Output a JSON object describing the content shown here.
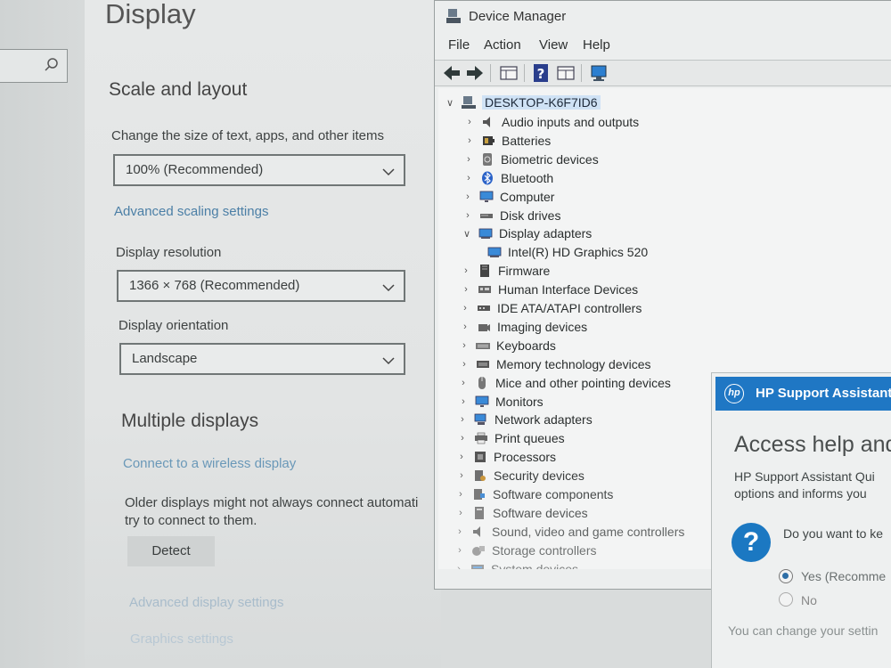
{
  "settings": {
    "title": "Display",
    "scale_heading": "Scale and layout",
    "scale_label": "Change the size of text, apps, and other items",
    "scale_value": "100% (Recommended)",
    "advanced_scaling_link": "Advanced scaling settings",
    "resolution_label": "Display resolution",
    "resolution_value": "1366 × 768 (Recommended)",
    "orientation_label": "Display orientation",
    "orientation_value": "Landscape",
    "multiple_heading": "Multiple displays",
    "wireless_link": "Connect to a wireless display",
    "older_text_1": "Older displays might not always connect automati",
    "older_text_2": "try to connect to them.",
    "detect_label": "Detect",
    "advanced_display_link": "Advanced display settings",
    "graphics_link": "Graphics settings"
  },
  "device_manager": {
    "title": "Device Manager",
    "menu": [
      "File",
      "Action",
      "View",
      "Help"
    ],
    "root": "DESKTOP-K6F7ID6",
    "items": [
      {
        "label": "Audio inputs and outputs",
        "icon": "speaker-icon",
        "expanded": false
      },
      {
        "label": "Batteries",
        "icon": "battery-icon",
        "expanded": false
      },
      {
        "label": "Biometric devices",
        "icon": "fingerprint-icon",
        "expanded": false
      },
      {
        "label": "Bluetooth",
        "icon": "bluetooth-icon",
        "expanded": false
      },
      {
        "label": "Computer",
        "icon": "monitor-icon",
        "expanded": false
      },
      {
        "label": "Disk drives",
        "icon": "disk-icon",
        "expanded": false
      },
      {
        "label": "Display adapters",
        "icon": "display-adapter-icon",
        "expanded": true
      },
      {
        "label": "Intel(R) HD Graphics 520",
        "icon": "display-adapter-icon",
        "child": true
      },
      {
        "label": "Firmware",
        "icon": "chip-icon",
        "expanded": false
      },
      {
        "label": "Human Interface Devices",
        "icon": "hid-icon",
        "expanded": false
      },
      {
        "label": "IDE ATA/ATAPI controllers",
        "icon": "controller-icon",
        "expanded": false
      },
      {
        "label": "Imaging devices",
        "icon": "camera-icon",
        "expanded": false
      },
      {
        "label": "Keyboards",
        "icon": "keyboard-icon",
        "expanded": false
      },
      {
        "label": "Memory technology devices",
        "icon": "memory-icon",
        "expanded": false
      },
      {
        "label": "Mice and other pointing devices",
        "icon": "mouse-icon",
        "expanded": false
      },
      {
        "label": "Monitors",
        "icon": "monitor-icon",
        "expanded": false
      },
      {
        "label": "Network adapters",
        "icon": "network-icon",
        "expanded": false
      },
      {
        "label": "Print queues",
        "icon": "printer-icon",
        "expanded": false
      },
      {
        "label": "Processors",
        "icon": "cpu-icon",
        "expanded": false
      },
      {
        "label": "Security devices",
        "icon": "security-icon",
        "expanded": false
      },
      {
        "label": "Software components",
        "icon": "puzzle-icon",
        "expanded": false
      },
      {
        "label": "Software devices",
        "icon": "software-device-icon",
        "expanded": false
      },
      {
        "label": "Sound, video and game controllers",
        "icon": "speaker-icon",
        "expanded": false
      },
      {
        "label": "Storage controllers",
        "icon": "storage-icon",
        "expanded": false
      },
      {
        "label": "System devices",
        "icon": "system-icon",
        "expanded": false
      }
    ]
  },
  "hp": {
    "title": "HP Support Assistant",
    "heading": "Access help and",
    "text_1": "HP Support Assistant Qui",
    "text_2": "options and informs you",
    "question": "Do you want to ke",
    "option_yes": "Yes (Recomme",
    "option_no": "No",
    "footer": "You can change your settin"
  },
  "colors": {
    "accent": "#1f77c4",
    "link": "#4b7fa6",
    "selection": "#cfe2f5"
  }
}
